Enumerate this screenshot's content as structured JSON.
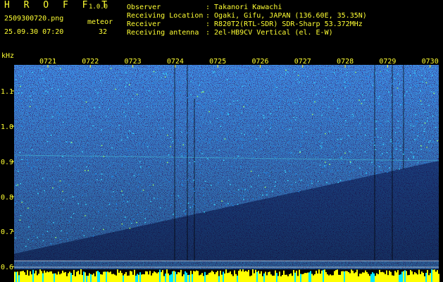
{
  "app": {
    "name": "H R O F F T",
    "version": "1.0.0"
  },
  "file": {
    "name": "2509300720.png",
    "datetime": "25.09.30 07:20"
  },
  "meteor": {
    "label": "meteor",
    "count": "32"
  },
  "info": [
    {
      "key": "Observer",
      "value": ": Takanori Kawachi"
    },
    {
      "key": "Receiving Location",
      "value": ": Ogaki, Gifu, JAPAN (136.60E, 35.35N)"
    },
    {
      "key": "Receiver",
      "value": ": R820T2(RTL-SDR) SDR-Sharp 53.372MHz"
    },
    {
      "key": "Receiving antenna",
      "value": ": 2el-HB9CV Vertical (el. E-W)"
    }
  ],
  "y_axis": {
    "unit": "kHz",
    "ticks": [
      "1.1",
      "1.0",
      "0.9",
      "0.8",
      "0.7",
      "0.6"
    ]
  },
  "x_axis": {
    "ticks": [
      "0721",
      "0722",
      "0723",
      "0724",
      "0725",
      "0726",
      "0727",
      "0728",
      "0729",
      "0730"
    ]
  },
  "colors": {
    "text": "#ffff33",
    "background": "#000000",
    "noise": "#1a237e",
    "signal": "#00e5ff",
    "level_bar": "#ffff00"
  }
}
